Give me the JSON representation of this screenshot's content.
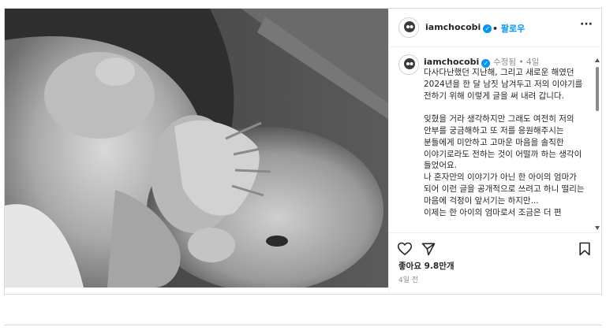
{
  "post": {
    "username": "iamchocobi",
    "follow_label": "팔로우",
    "more_label": "···",
    "caption_username": "iamchocobi",
    "edited_label": "수정됨",
    "caption_age": "4일",
    "caption": "다사다난했던 지난해, 그리고 새로운 해였던 2024년을 한 달 남짓 남겨두고 저의 이야기를 전하기 위해 이렇게 글을 써 내려 갑니다.\n\n잊혔을 거라 생각하지만 그래도 여전히 저의 안부를 궁금해하고 또 저를 응원해주시는 분들에게 미안하고 고마운 마음을 솔직한 이야기로라도 전하는 것이 어떨까 하는 생각이 들었어요.\n나 혼자만의 이야기가 아닌 한 아이의 엄마가 되어 이런 글을 공개적으로 쓰려고 하니 떨리는 마음에 걱정이 앞서기는 하지만...\n이제는 한 아이의 엄마로서 조금은 더 편",
    "likes": "좋아요 9.8만개",
    "date": "4일 전"
  },
  "icons": {
    "verified": "verified-badge-icon",
    "heart": "heart-icon",
    "share": "paper-plane-icon",
    "bookmark": "bookmark-icon",
    "scroll_up": "scroll-up-arrow-icon",
    "scroll_down": "scroll-down-arrow-icon"
  },
  "colors": {
    "accent": "#0095f6",
    "text": "#262626",
    "muted": "#8e8e8e",
    "border": "#dbdbdb"
  }
}
